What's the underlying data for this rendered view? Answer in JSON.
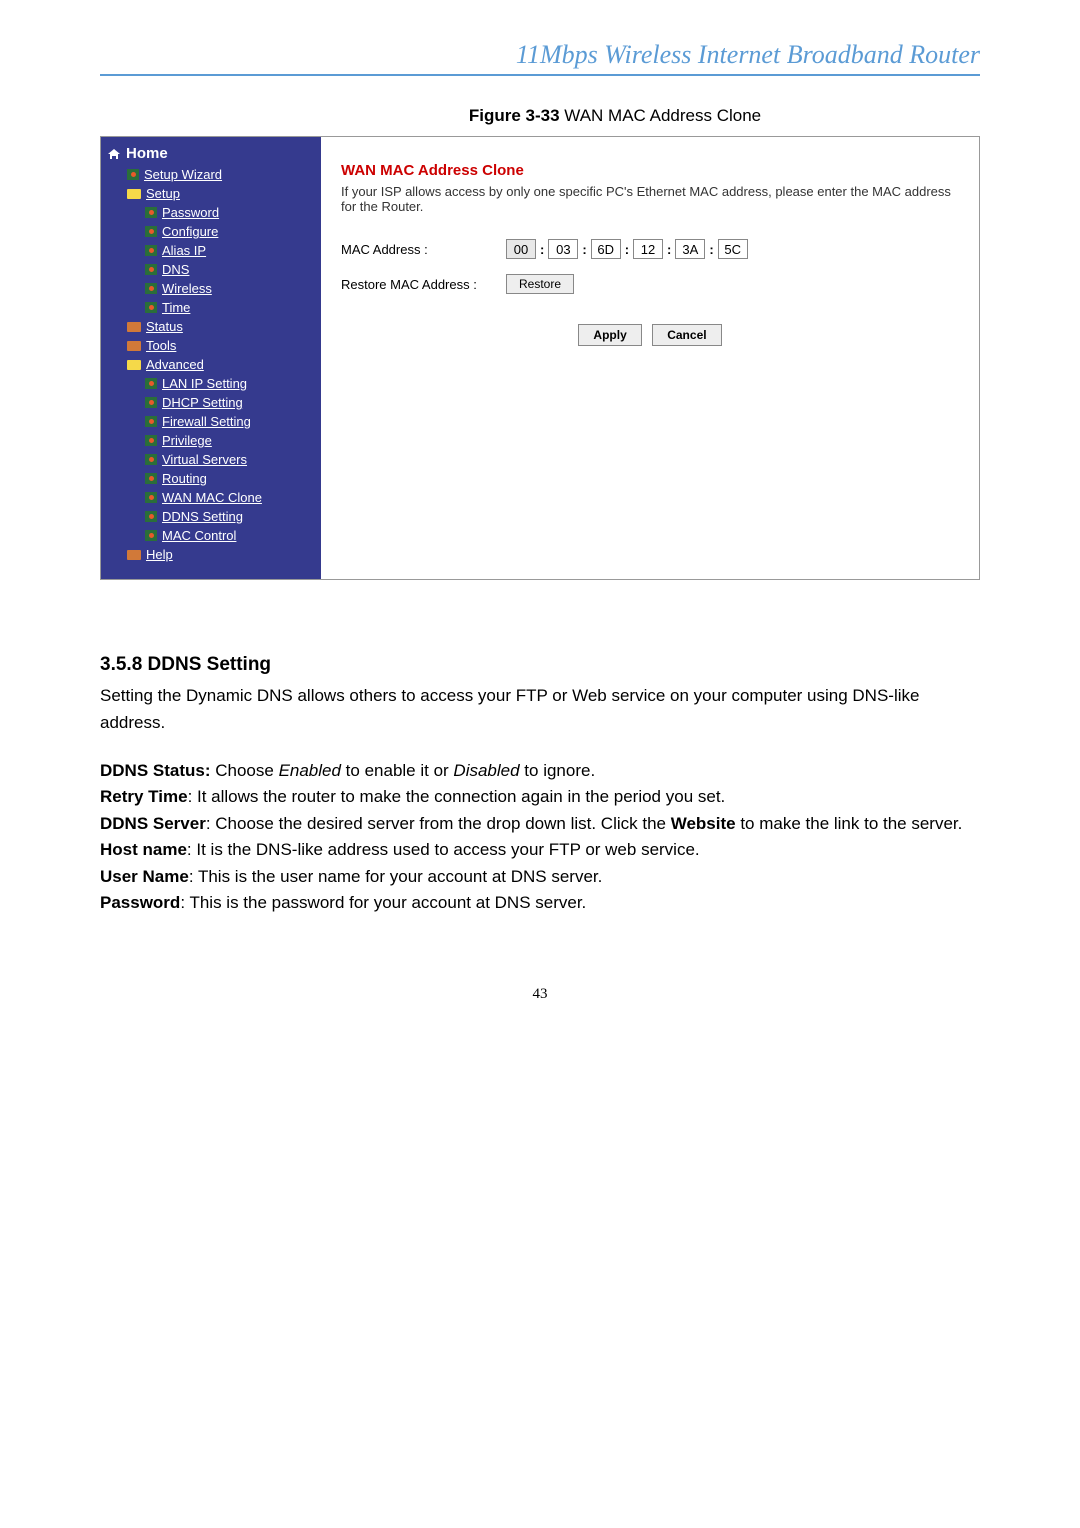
{
  "header": "11Mbps  Wireless  Internet  Broadband  Router",
  "figure_caption_prefix": "Figure 3-33",
  "figure_caption_rest": " WAN MAC Address Clone",
  "sidebar": {
    "home": "Home",
    "setup_wizard": "Setup Wizard",
    "setup": "Setup",
    "password": "Password",
    "configure": "Configure",
    "alias_ip": "Alias IP",
    "dns": "DNS",
    "wireless": "Wireless",
    "time": "Time",
    "status": "Status",
    "tools": "Tools",
    "advanced": "Advanced",
    "lan_ip": "LAN IP Setting",
    "dhcp": "DHCP Setting",
    "firewall": "Firewall Setting",
    "privilege": "Privilege",
    "virtual_servers": "Virtual Servers",
    "routing": "Routing",
    "wan_mac": "WAN MAC Clone",
    "ddns": "DDNS Setting",
    "mac_control": "MAC Control",
    "help": "Help"
  },
  "panel": {
    "title": "WAN MAC Address Clone",
    "desc": "If your ISP allows access by only one specific PC's Ethernet MAC address, please enter the MAC address for the Router.",
    "mac_label": "MAC Address :",
    "restore_label": "Restore MAC Address :",
    "mac": [
      "00",
      "03",
      "6D",
      "12",
      "3A",
      "5C"
    ],
    "restore_btn": "Restore",
    "apply_btn": "Apply",
    "cancel_btn": "Cancel",
    "separator": ":"
  },
  "section": {
    "heading": "3.5.8 DDNS Setting",
    "intro": "Setting the Dynamic DNS allows others to access your FTP or Web service on your computer using DNS-like address.",
    "ddns_status_label": "DDNS Status:",
    "ddns_status_text1": " Choose ",
    "ddns_status_enabled": "Enabled",
    "ddns_status_text2": " to enable it or ",
    "ddns_status_disabled": "Disabled",
    "ddns_status_text3": " to ignore.",
    "retry_label": "Retry Time",
    "retry_text": ": It allows the router to make the connection again in the period you set.",
    "server_label": "DDNS Server",
    "server_text1": ": Choose the desired server from the drop down list. Click the ",
    "server_website": "Website",
    "server_text2": " to make the link to the server.",
    "host_label": "Host name",
    "host_text": ": It is the DNS-like address used to access your FTP or web service.",
    "user_label": "User Name",
    "user_text": ": This is the user name for your account at DNS server.",
    "pass_label": "Password",
    "pass_text": ": This is the password for your account at DNS server."
  },
  "page_number": "43"
}
